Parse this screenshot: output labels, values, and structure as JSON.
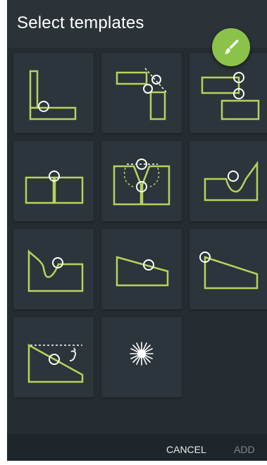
{
  "dialog": {
    "title": "Select templates",
    "fab_icon": "paint-brush-icon",
    "templates": [
      {
        "icon": "corner-joint-icon"
      },
      {
        "icon": "offset-corner-joint-icon"
      },
      {
        "icon": "stacked-lap-joint-icon"
      },
      {
        "icon": "butt-joint-icon"
      },
      {
        "icon": "v-groove-joint-icon"
      },
      {
        "icon": "j-groove-icon"
      },
      {
        "icon": "u-groove-icon"
      },
      {
        "icon": "bevel-edge-icon"
      },
      {
        "icon": "slope-edge-icon"
      },
      {
        "icon": "wedge-fillet-icon"
      },
      {
        "icon": "spark-icon"
      }
    ],
    "footer": {
      "cancel_label": "CANCEL",
      "add_label": "ADD"
    }
  },
  "colors": {
    "background": "#252d33",
    "tile": "#2c353b",
    "accent": "#8bc34a",
    "stroke": "#b7d35c"
  }
}
